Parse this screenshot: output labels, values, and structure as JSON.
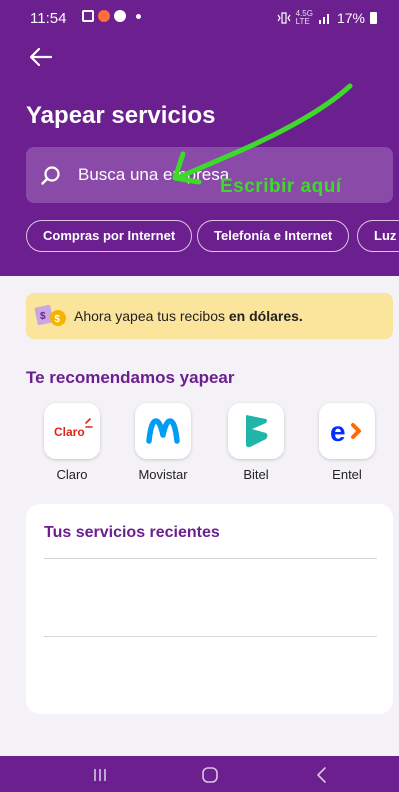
{
  "status_bar": {
    "time": "11:54",
    "network_top": "4.5G",
    "network_bottom": "LTE",
    "battery_percent": "17%"
  },
  "header": {
    "title": "Yapear servicios",
    "search_placeholder": "Busca una empresa",
    "annotation": "Escribir aquí",
    "chips": [
      {
        "label": "Compras por Internet"
      },
      {
        "label": "Telefonía e Internet"
      },
      {
        "label": "Luz"
      }
    ]
  },
  "banner": {
    "text": "Ahora yapea tus recibos ",
    "bold": "en dólares."
  },
  "recommended": {
    "title": "Te recomendamos yapear",
    "providers": [
      {
        "name": "Claro",
        "logo_text": "Claro",
        "color": "#e3231b"
      },
      {
        "name": "Movistar",
        "logo_text": "M",
        "color": "#019df4"
      },
      {
        "name": "Bitel",
        "logo_text": "B",
        "color": "#1fb5a8"
      },
      {
        "name": "Entel",
        "logo_text": "e",
        "color": "#002eff",
        "accent": "#ff6b00"
      }
    ]
  },
  "recent": {
    "title": "Tus servicios recientes"
  },
  "colors": {
    "brand": "#6c1f8f",
    "annotation": "#3cdb2a",
    "banner": "#fbe49c"
  }
}
